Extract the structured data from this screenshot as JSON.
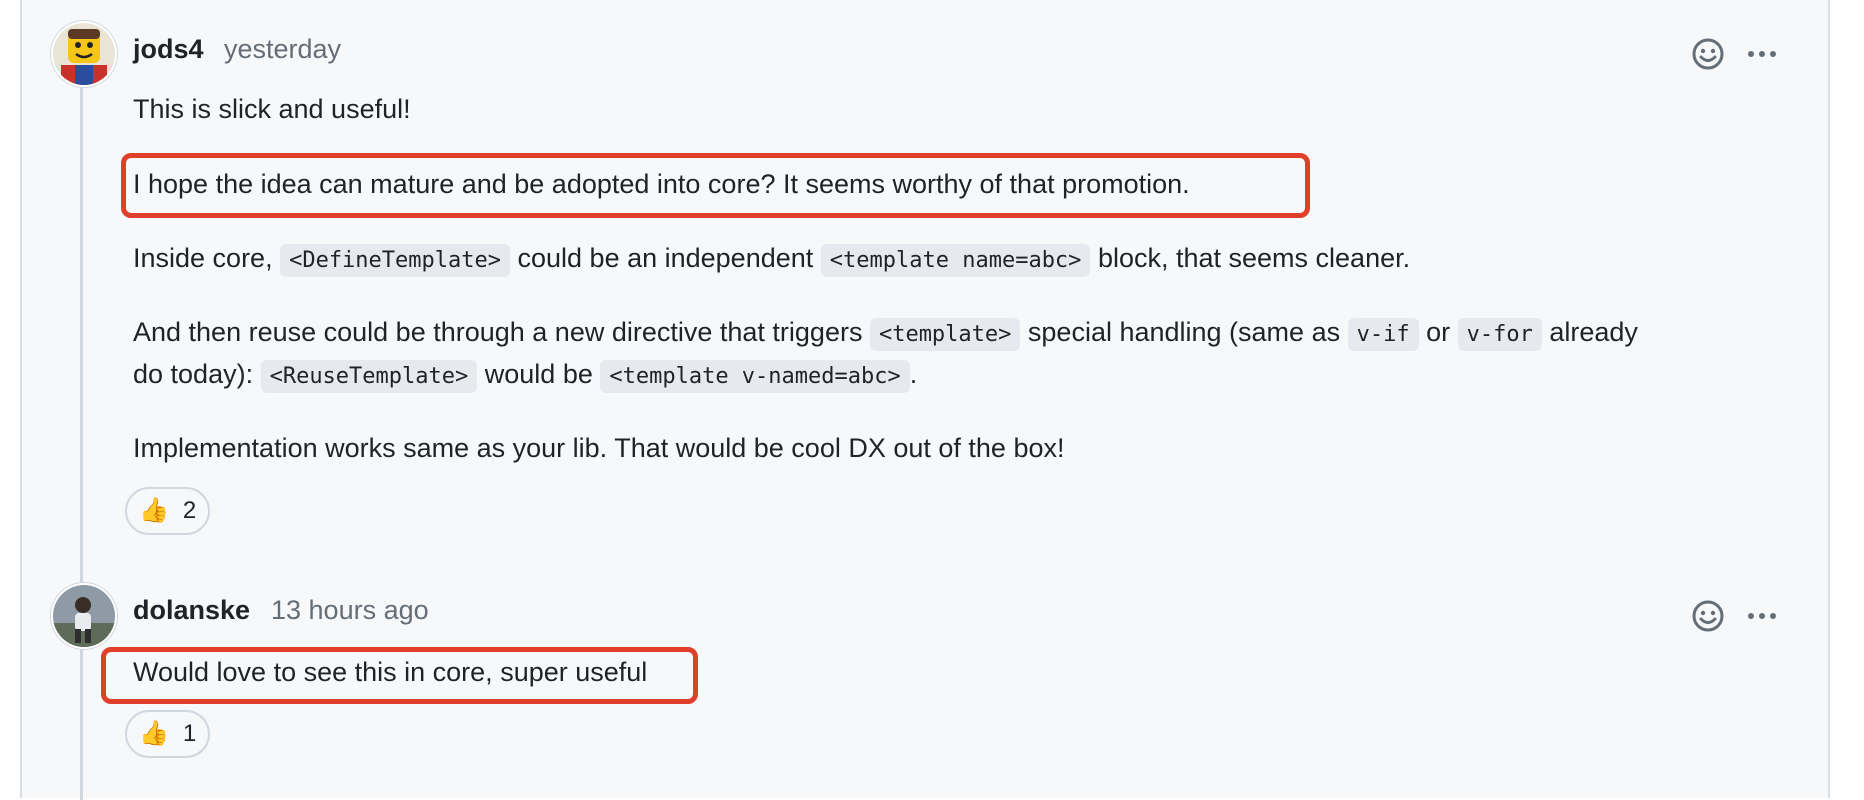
{
  "comments": [
    {
      "author": "jods4",
      "time": "yesterday",
      "paragraphs": {
        "p1": "This is slick and useful!",
        "p2": "I hope the idea can mature and be adopted into core? It seems worthy of that promotion.",
        "p3": {
          "t1": "Inside core, ",
          "c1": "<DefineTemplate>",
          "t2": " could be an independent ",
          "c2": "<template name=abc>",
          "t3": " block, that seems cleaner."
        },
        "p4": {
          "t1": "And then reuse could be through a new directive that triggers ",
          "c1": "<template>",
          "t2": " special handling (same as ",
          "c2": "v-if",
          "t3": " or ",
          "c3": "v-for",
          "t4": " already",
          "t5": "do today): ",
          "c4": "<ReuseTemplate>",
          "t6": " would be ",
          "c5": "<template v-named=abc>",
          "t7": "."
        },
        "p5": "Implementation works same as your lib. That would be cool DX out of the box!"
      },
      "reaction": {
        "emoji": "👍",
        "count": "2",
        "icon": "thumbs-up-icon"
      }
    },
    {
      "author": "dolanske",
      "time": "13 hours ago",
      "paragraphs": {
        "p1": "Would love to see this in core, super useful"
      },
      "reaction": {
        "emoji": "👍",
        "count": "1",
        "icon": "thumbs-up-icon"
      }
    }
  ],
  "icons": {
    "add_reaction": "smiley-icon",
    "more_options": "kebab-horizontal-icon"
  },
  "colors": {
    "highlight": "#e0402a",
    "muted_text": "#656d76",
    "panel_bg": "#f6f8fa"
  }
}
